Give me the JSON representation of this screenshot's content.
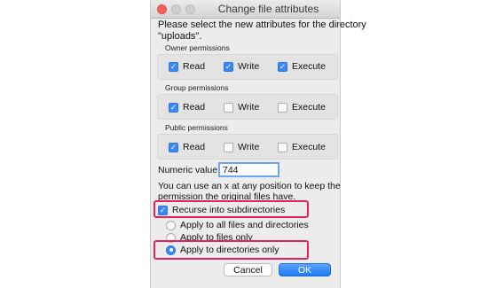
{
  "window": {
    "title": "Change file attributes"
  },
  "intro": {
    "line1": "Please select the new attributes for the directory",
    "line2": "\"uploads\"."
  },
  "groups": [
    {
      "label": "Owner permissions",
      "options": [
        {
          "label": "Read",
          "checked": true
        },
        {
          "label": "Write",
          "checked": true
        },
        {
          "label": "Execute",
          "checked": true
        }
      ]
    },
    {
      "label": "Group permissions",
      "options": [
        {
          "label": "Read",
          "checked": true
        },
        {
          "label": "Write",
          "checked": false
        },
        {
          "label": "Execute",
          "checked": false
        }
      ]
    },
    {
      "label": "Public permissions",
      "options": [
        {
          "label": "Read",
          "checked": true
        },
        {
          "label": "Write",
          "checked": false
        },
        {
          "label": "Execute",
          "checked": false
        }
      ]
    }
  ],
  "numeric": {
    "label": "Numeric value:",
    "value": "744"
  },
  "help": {
    "line1": "You can use an x at any position to keep the",
    "line2": "permission the original files have."
  },
  "recurse": {
    "label": "Recurse into subdirectories",
    "checked": true
  },
  "apply_options": [
    {
      "label": "Apply to all files and directories",
      "selected": false
    },
    {
      "label": "Apply to files only",
      "selected": false
    },
    {
      "label": "Apply to directories only",
      "selected": true
    }
  ],
  "buttons": {
    "cancel": "Cancel",
    "ok": "OK"
  },
  "colors": {
    "accent": "#3a88f5",
    "highlight": "#e0245e",
    "close": "#fc605c"
  },
  "icons": {
    "checkmark": "check-icon"
  }
}
